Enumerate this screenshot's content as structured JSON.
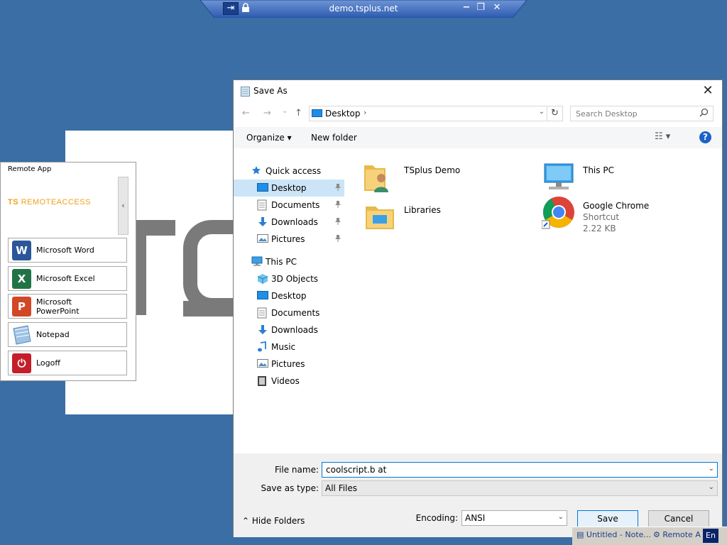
{
  "remote_bar": {
    "title": "demo.tsplus.net",
    "pin_glyph": "⇥",
    "lock_glyph": "🔒",
    "minimize_glyph": "−",
    "restore_glyph": "❐",
    "close_glyph": "✕"
  },
  "remote_app": {
    "title": "Remote App",
    "logo_ts": "TS",
    "logo_text": "REMOTEACCESS",
    "collapse_glyph": "‹",
    "apps": [
      {
        "label": "Microsoft Word",
        "icon": "word-icon",
        "color": "#2b579a",
        "letter": "W"
      },
      {
        "label": "Microsoft Excel",
        "icon": "excel-icon",
        "color": "#217346",
        "letter": "X"
      },
      {
        "label": "Microsoft PowerPoint",
        "icon": "powerpoint-icon",
        "color": "#d24726",
        "letter": "P"
      },
      {
        "label": "Notepad",
        "icon": "notepad-icon",
        "color": "#9ec3e6",
        "letter": ""
      },
      {
        "label": "Logoff",
        "icon": "power-icon",
        "color": "#c41e2a",
        "letter": "⏻"
      }
    ]
  },
  "dialog": {
    "title": "Save As",
    "close_glyph": "✕",
    "nav": {
      "back": "←",
      "forward": "→",
      "recent": "⌄",
      "up": "↑"
    },
    "path": {
      "location": "Desktop",
      "arrow": "›",
      "dropdown": "⌄",
      "refresh": "↻"
    },
    "search_placeholder": "Search Desktop",
    "toolbar": {
      "organize": "Organize ▾",
      "new_folder": "New folder",
      "view": "☷ ▾",
      "help": "?"
    },
    "nav_pane": [
      {
        "label": "Quick access",
        "icon": "star-icon",
        "indent": 0,
        "pinned": false,
        "selected": false
      },
      {
        "label": "Desktop",
        "icon": "desktop-icon",
        "indent": 1,
        "pinned": true,
        "selected": true
      },
      {
        "label": "Documents",
        "icon": "documents-icon",
        "indent": 1,
        "pinned": true,
        "selected": false
      },
      {
        "label": "Downloads",
        "icon": "download-icon",
        "indent": 1,
        "pinned": true,
        "selected": false
      },
      {
        "label": "Pictures",
        "icon": "pictures-icon",
        "indent": 1,
        "pinned": true,
        "selected": false
      },
      {
        "label": "This PC",
        "icon": "computer-icon",
        "indent": 0,
        "pinned": false,
        "selected": false
      },
      {
        "label": "3D Objects",
        "icon": "cube-icon",
        "indent": 1,
        "pinned": false,
        "selected": false
      },
      {
        "label": "Desktop",
        "icon": "desktop-icon",
        "indent": 1,
        "pinned": false,
        "selected": false
      },
      {
        "label": "Documents",
        "icon": "documents-icon",
        "indent": 1,
        "pinned": false,
        "selected": false
      },
      {
        "label": "Downloads",
        "icon": "download-icon",
        "indent": 1,
        "pinned": false,
        "selected": false
      },
      {
        "label": "Music",
        "icon": "music-icon",
        "indent": 1,
        "pinned": false,
        "selected": false
      },
      {
        "label": "Pictures",
        "icon": "pictures-icon",
        "indent": 1,
        "pinned": false,
        "selected": false
      },
      {
        "label": "Videos",
        "icon": "video-icon",
        "indent": 1,
        "pinned": false,
        "selected": false
      }
    ],
    "pin_glyph": "📌",
    "items": [
      {
        "name": "TSplus Demo",
        "sub1": "",
        "sub2": "",
        "icon": "user-folder-icon"
      },
      {
        "name": "This PC",
        "sub1": "",
        "sub2": "",
        "icon": "computer-icon"
      },
      {
        "name": "Libraries",
        "sub1": "",
        "sub2": "",
        "icon": "libraries-icon"
      },
      {
        "name": "Google Chrome",
        "sub1": "Shortcut",
        "sub2": "2.22 KB",
        "icon": "chrome-icon"
      }
    ],
    "file_name_label": "File name:",
    "file_name_value": "coolscript.b at",
    "save_type_label": "Save as type:",
    "save_type_value": "All Files",
    "hide_folders": "Hide Folders",
    "encoding_label": "Encoding:",
    "encoding_value": "ANSI",
    "save_button": "Save",
    "cancel_button": "Cancel",
    "dropdown_glyph": "⌄",
    "hide_glyph": "⌃"
  },
  "taskbar": {
    "items": [
      "Untitled - Note...",
      "Remote A"
    ],
    "lang": "En"
  },
  "colors": {
    "desktop": "#3a6ea5",
    "selection": "#cce4f7",
    "accent": "#0078d7"
  }
}
